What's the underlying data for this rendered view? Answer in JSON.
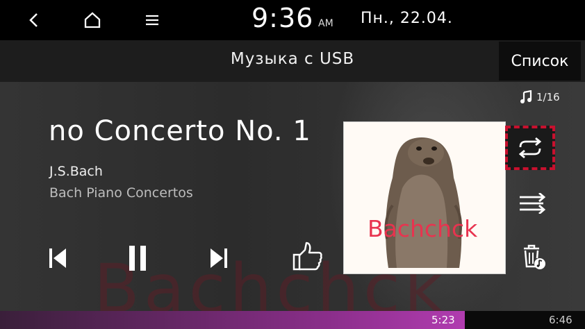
{
  "topbar": {
    "time": "9:36",
    "ampm": "AM",
    "date": "Пн., 22.04.",
    "icons": [
      "back-icon",
      "home-icon",
      "menu-icon"
    ]
  },
  "header": {
    "title": "Музыка с USB",
    "list_label": "Список"
  },
  "player": {
    "track_title": "no Concerto No. 1",
    "artist": "J.S.Bach",
    "album": "Bach Piano Concertos",
    "track_counter": "1/16",
    "album_art_text": "Bachchck",
    "background_text": "Bachchck",
    "controls": [
      "previous-icon",
      "pause-icon",
      "next-icon",
      "thumbs-up-icon"
    ],
    "side_controls": [
      "music-note-icon",
      "repeat-icon",
      "shuffle-icon",
      "delete-icon"
    ]
  },
  "progress": {
    "elapsed": "5:23",
    "total": "6:46",
    "fraction": 0.795,
    "colors": {
      "fill": "#b13cb0",
      "highlight": "#c8102e"
    }
  }
}
